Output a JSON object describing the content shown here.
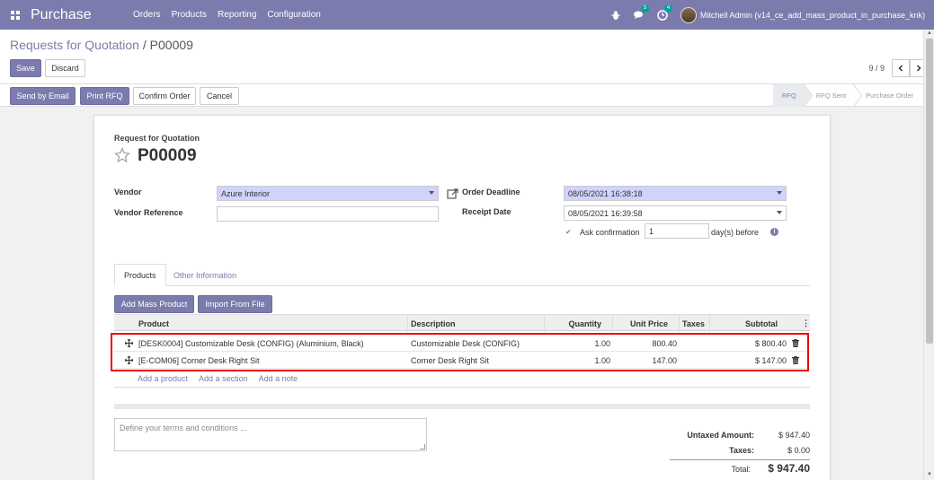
{
  "navbar": {
    "app_name": "Purchase",
    "menu": [
      "Orders",
      "Products",
      "Reporting",
      "Configuration"
    ],
    "messages_count": "5",
    "activities_count": "4",
    "user": "Mitchell Admin (v14_ce_add_mass_product_in_purchase_knk)"
  },
  "control_panel": {
    "breadcrumb_parent": "Requests for Quotation",
    "breadcrumb_sep": " / ",
    "breadcrumb_current": "P00009",
    "save": "Save",
    "discard": "Discard",
    "pager": "9 / 9"
  },
  "statusbar": {
    "buttons": [
      "Send by Email",
      "Print RFQ",
      "Confirm Order",
      "Cancel"
    ],
    "steps": [
      "RFQ",
      "RFQ Sent",
      "Purchase Order"
    ],
    "active_step": "RFQ"
  },
  "form": {
    "doc_type": "Request for Quotation",
    "doc_name": "P00009",
    "vendor_label": "Vendor",
    "vendor_value": "Azure Interior",
    "vendor_ref_label": "Vendor Reference",
    "vendor_ref_value": "",
    "order_deadline_label": "Order Deadline",
    "order_deadline_value": "08/05/2021 16:38:18",
    "receipt_date_label": "Receipt Date",
    "receipt_date_value": "08/05/2021 16:39:58",
    "ask_confirmation_label": "Ask confirmation",
    "ask_confirmation_days": "1",
    "days_before": "day(s) before"
  },
  "tabs": [
    "Products",
    "Other Information"
  ],
  "actions": {
    "add_mass_product": "Add Mass Product",
    "import_from_file": "Import From File"
  },
  "table": {
    "headers": [
      "Product",
      "Description",
      "Quantity",
      "Unit Price",
      "Taxes",
      "Subtotal"
    ],
    "rows": [
      {
        "product": "[DESK0004] Customizable Desk (CONFIG) (Aluminium, Black)",
        "description": "Customizable Desk (CONFIG)",
        "quantity": "1.00",
        "unit_price": "800.40",
        "taxes": "",
        "subtotal": "$ 800.40"
      },
      {
        "product": "[E-COM06] Corner Desk Right Sit",
        "description": "Corner Desk Right Sit",
        "quantity": "1.00",
        "unit_price": "147.00",
        "taxes": "",
        "subtotal": "$ 147.00"
      }
    ],
    "add_links": [
      "Add a product",
      "Add a section",
      "Add a note"
    ]
  },
  "notes_placeholder": "Define your terms and conditions ...",
  "totals": {
    "untaxed_label": "Untaxed Amount:",
    "untaxed_value": "$ 947.40",
    "taxes_label": "Taxes:",
    "taxes_value": "$ 0.00",
    "total_label": "Total:",
    "total_value": "$ 947.40"
  },
  "colors": {
    "brand": "#7c7bad",
    "required_field": "#d2d2ff",
    "highlight": "#ee0000"
  }
}
